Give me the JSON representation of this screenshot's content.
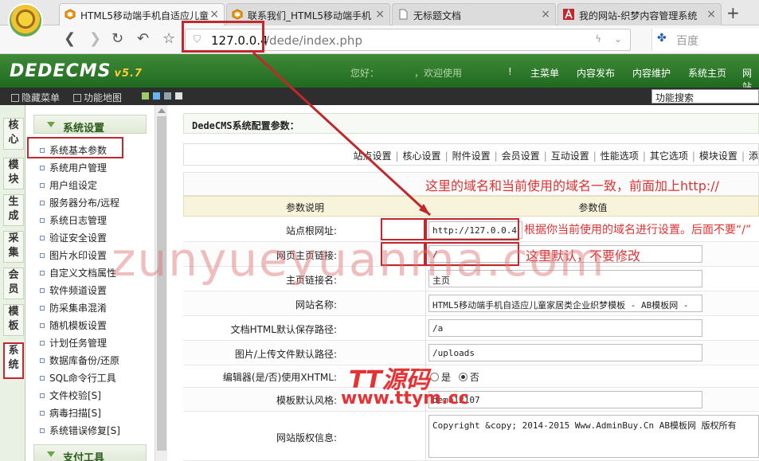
{
  "tabs": [
    {
      "label": "HTML5移动端手机自适应儿童",
      "icon": "dede-icon",
      "active": true
    },
    {
      "label": "联系我们_HTML5移动端手机",
      "icon": "dede-icon",
      "active": false
    },
    {
      "label": "无标题文档",
      "icon": "page-icon",
      "active": false
    },
    {
      "label": "我的网站-织梦内容管理系统",
      "icon": "a-icon",
      "active": false
    }
  ],
  "address": {
    "host": "127.0.0.4",
    "path": "/dede/index.php"
  },
  "search_engine": "百度",
  "header": {
    "logo": "DEDECMS",
    "version": "v5.7",
    "greeting": "您好：",
    "welcome": "，欢迎使用",
    "bang": "!",
    "menu": [
      "主菜单",
      "内容发布",
      "内容维护",
      "系统主页",
      "网站"
    ]
  },
  "toolbar": {
    "hide_menu": "隐藏菜单",
    "func_map": "功能地图",
    "func_search": "功能搜索"
  },
  "vtabs": [
    "核心",
    "模块",
    "生成",
    "采集",
    "会员",
    "模板",
    "系统"
  ],
  "tree": {
    "category": "系统设置",
    "items": [
      "系统基本参数",
      "系统用户管理",
      "用户组设定",
      "服务器分布/远程",
      "系统日志管理",
      "验证安全设置",
      "图片水印设置",
      "自定义文档属性",
      "软件频道设置",
      "防采集串混淆",
      "随机模板设置",
      "计划任务管理",
      "数据库备份/还原",
      "SQL命令行工具",
      "文件校验[S]",
      "病毒扫描[S]",
      "系统错误修复[S]"
    ],
    "category2": "支付工具"
  },
  "main": {
    "title": "DedeCMS系统配置参数：",
    "subnav": [
      "站点设置",
      "核心设置",
      "附件设置",
      "会员设置",
      "互动设置",
      "性能选项",
      "其它选项",
      "模块设置",
      "添"
    ],
    "col_desc": "参数说明",
    "col_val": "参数值",
    "rows": [
      {
        "label": "站点根网址:",
        "value": "http://127.0.0.4"
      },
      {
        "label": "网页主页链接:",
        "value": "/"
      },
      {
        "label": "主页链接名:",
        "value": "主页"
      },
      {
        "label": "网站名称:",
        "value": "HTML5移动端手机自适应儿童家居类企业织梦模板 - AB模板网 -"
      },
      {
        "label": "文档HTML默认保存路径:",
        "value": "/a"
      },
      {
        "label": "图片/上传文件默认路径:",
        "value": "/uploads"
      },
      {
        "label": "编辑器(是/否)使用XHTML:",
        "opt_yes": "是",
        "opt_no": "否"
      },
      {
        "label": "模板默认风格:",
        "value": "demo12107"
      },
      {
        "label": "网站版权信息:",
        "value": "Copyright &copy; 2014-2015 Www.AdminBuy.Cn AB模板网 版权所有"
      }
    ]
  },
  "annotations": {
    "domain_note": "这里的域名和当前使用的域名一致，前面加上http://",
    "root_note": "根据你当前使用的域名进行设置。后面不要“/”",
    "home_note": "这里默认，不要修改"
  },
  "watermark": "zunyueyuanma.com",
  "tt_logo": "TT源码",
  "tt_url": "www.ttym.cc",
  "colors": {
    "accent_red": "#c0282d",
    "header_green": "#2f7a2a"
  }
}
